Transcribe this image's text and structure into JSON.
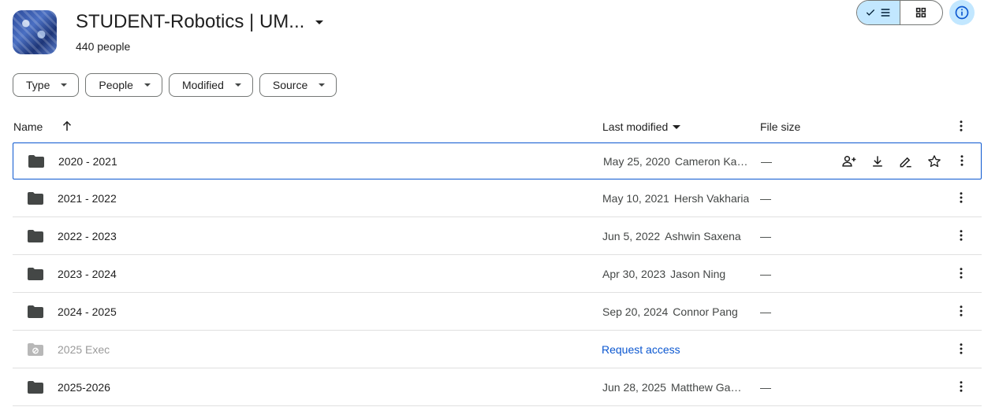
{
  "header": {
    "title": "STUDENT-Robotics | UM...",
    "subtitle": "440 people"
  },
  "filters": [
    "Type",
    "People",
    "Modified",
    "Source"
  ],
  "columns": {
    "name": "Name",
    "last_modified": "Last modified",
    "file_size": "File size"
  },
  "rows": [
    {
      "name": "2020 - 2021",
      "date": "May 25, 2020",
      "owner": "Cameron Kabacinski",
      "size": "—"
    },
    {
      "name": "2021 - 2022",
      "date": "May 10, 2021",
      "owner": "Hersh Vakharia",
      "size": "—"
    },
    {
      "name": "2022 - 2023",
      "date": "Jun 5, 2022",
      "owner": "Ashwin Saxena",
      "size": "—"
    },
    {
      "name": "2023 - 2024",
      "date": "Apr 30, 2023",
      "owner": "Jason Ning",
      "size": "—"
    },
    {
      "name": "2024 - 2025",
      "date": "Sep 20, 2024",
      "owner": "Connor Pang",
      "size": "—"
    },
    {
      "name": "2025 Exec",
      "request": "Request access"
    },
    {
      "name": "2025-2026",
      "date": "Jun 28, 2025",
      "owner": "Matthew Gawarecki",
      "size": "—"
    }
  ],
  "colors": {
    "accent": "#0b57d0",
    "selected_toggle": "#c2e7ff"
  }
}
